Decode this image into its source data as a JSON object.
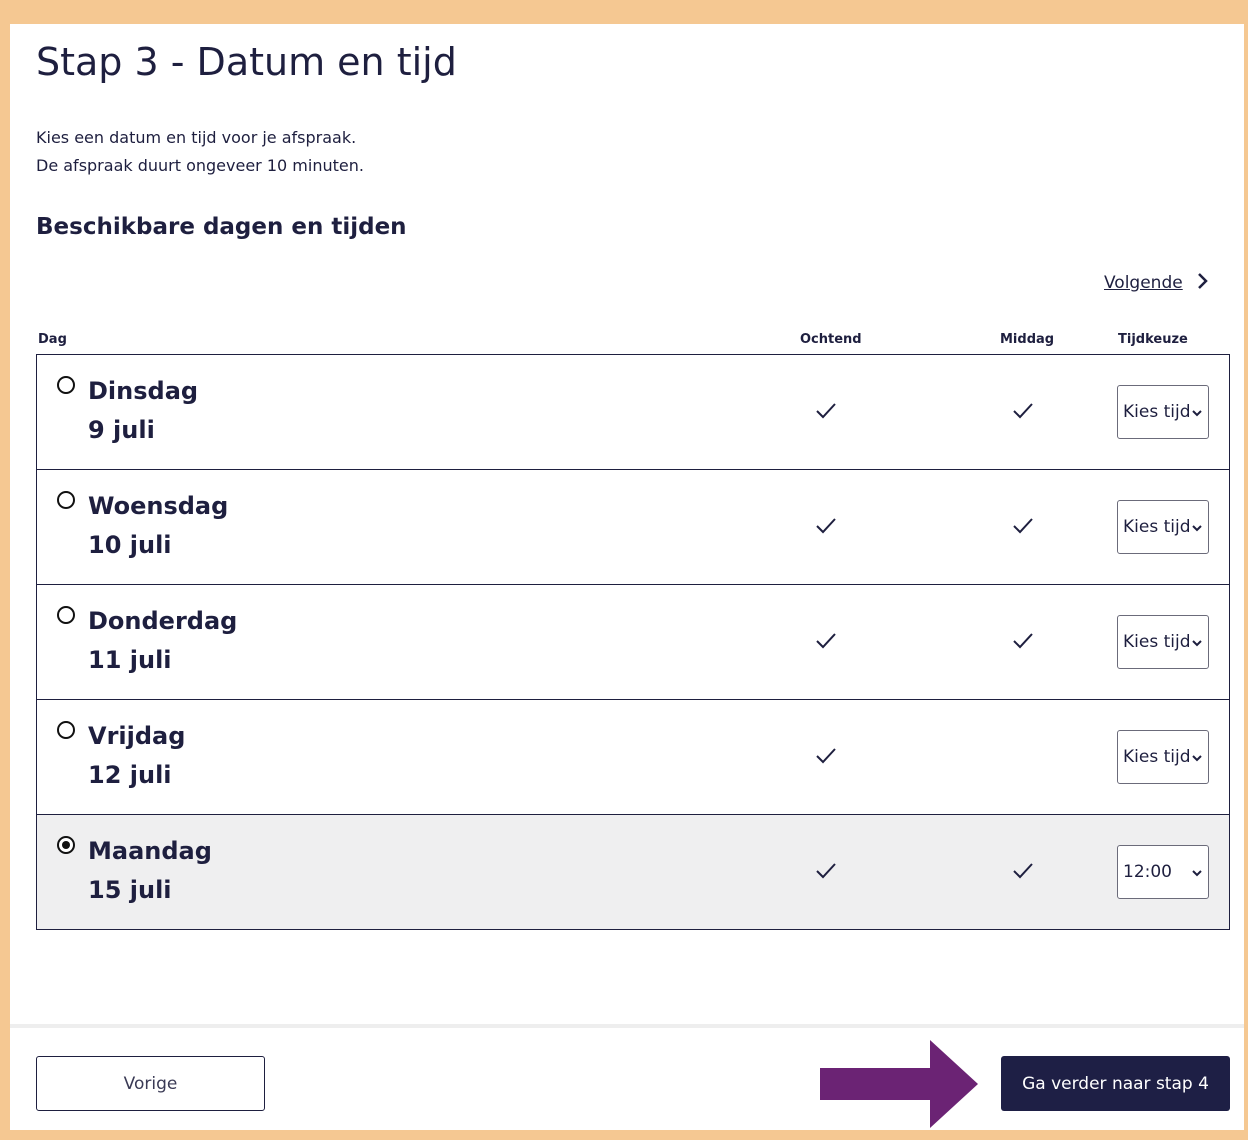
{
  "page": {
    "title": "Stap 3 - Datum en tijd",
    "intro_line1": "Kies een datum en tijd voor je afspraak.",
    "intro_line2": "De afspraak duurt ongeveer 10 minuten.",
    "subtitle": "Beschikbare dagen en tijden",
    "next_link": "Volgende"
  },
  "table": {
    "headers": {
      "day": "Dag",
      "morning": "Ochtend",
      "afternoon": "Middag",
      "time": "Tijdkeuze"
    },
    "rows": [
      {
        "day": "Dinsdag",
        "date": "9 juli",
        "morning": true,
        "afternoon": true,
        "time": "Kies tijd",
        "selected": false
      },
      {
        "day": "Woensdag",
        "date": "10 juli",
        "morning": true,
        "afternoon": true,
        "time": "Kies tijd",
        "selected": false
      },
      {
        "day": "Donderdag",
        "date": "11 juli",
        "morning": true,
        "afternoon": true,
        "time": "Kies tijd",
        "selected": false
      },
      {
        "day": "Vrijdag",
        "date": "12 juli",
        "morning": true,
        "afternoon": false,
        "time": "Kies tijd",
        "selected": false
      },
      {
        "day": "Maandag",
        "date": "15 juli",
        "morning": true,
        "afternoon": true,
        "time": "12:00",
        "selected": true
      }
    ]
  },
  "footer": {
    "prev_label": "Vorige",
    "next_label": "Ga verder naar stap 4"
  },
  "colors": {
    "frame": "#f5c892",
    "primary": "#1e1f45",
    "arrow": "#6b2374",
    "selected_row": "#efeff0"
  }
}
